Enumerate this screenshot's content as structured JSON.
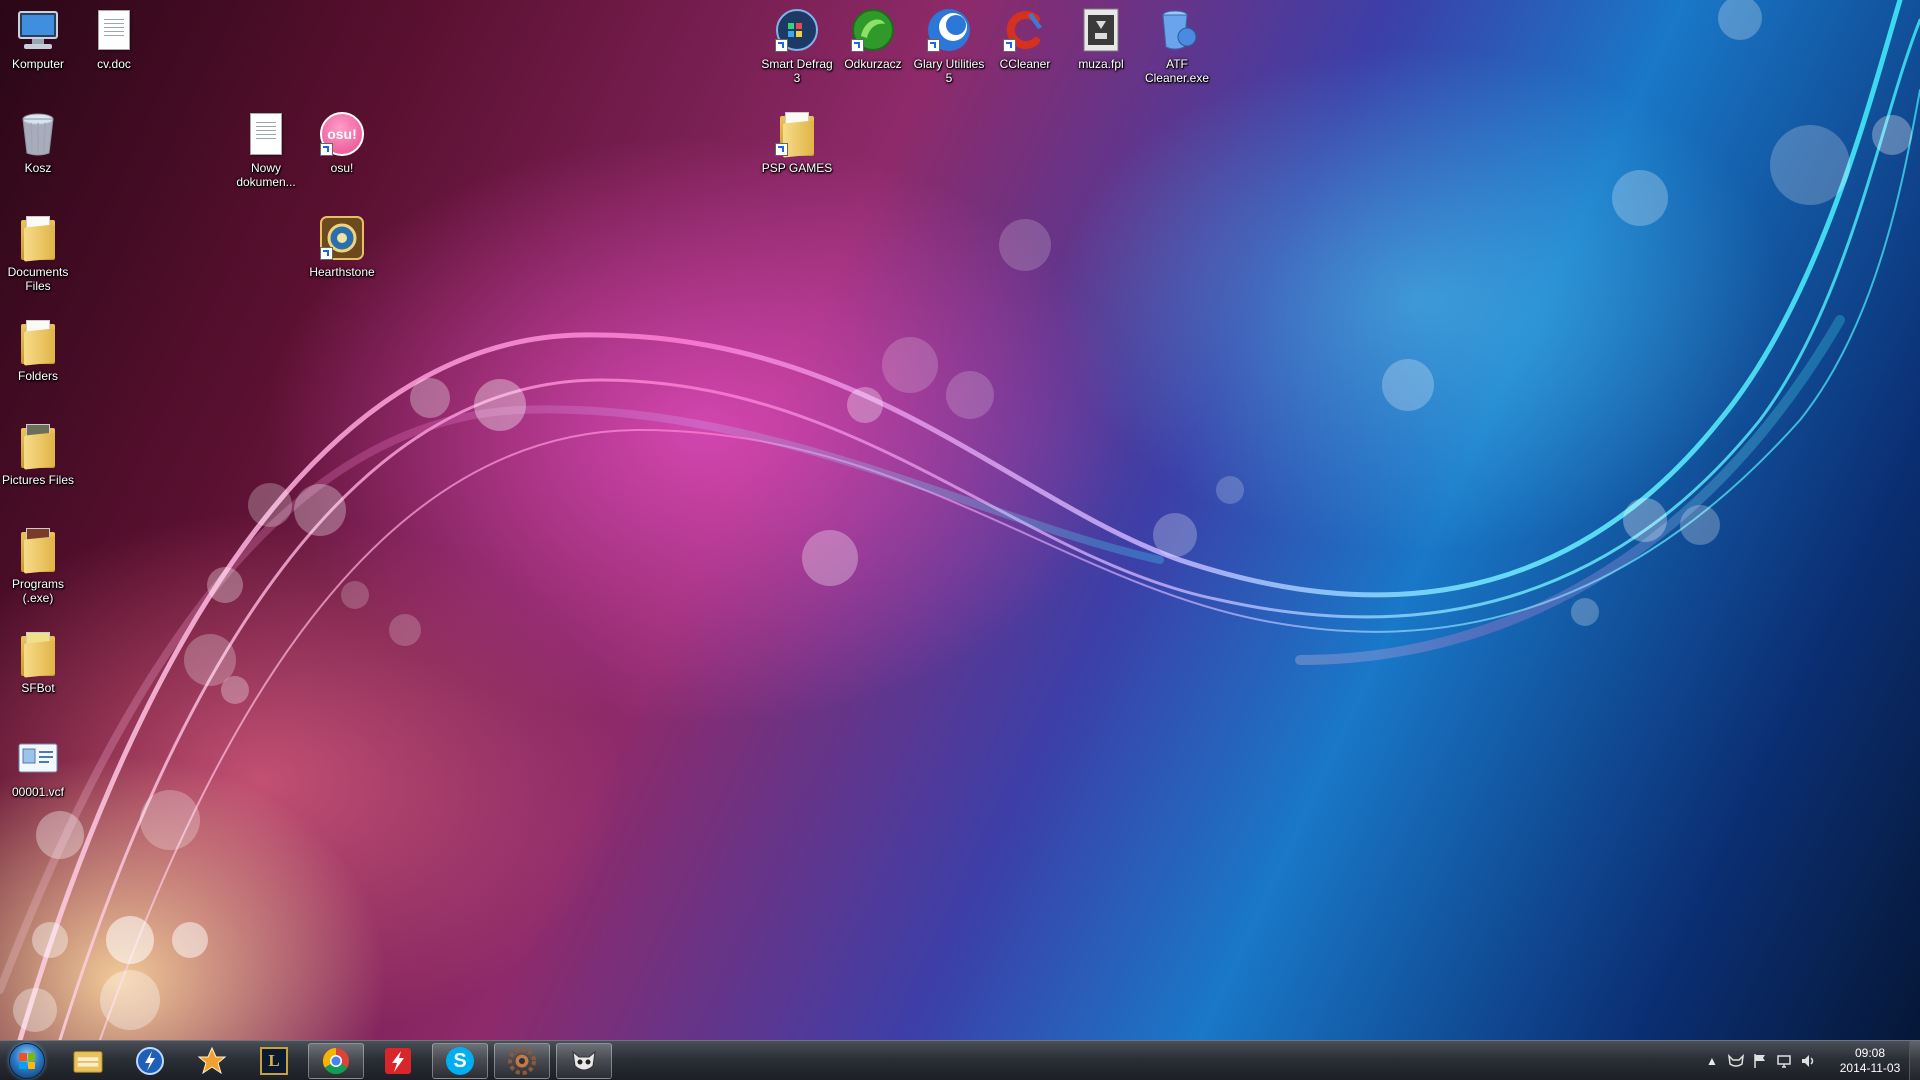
{
  "desktop": {
    "icons": {
      "komputer": "Komputer",
      "cv_doc": "cv.doc",
      "kosz": "Kosz",
      "nowy_dokument": "Nowy dokumen...",
      "osu": "osu!",
      "osu_logo_text": "osu!",
      "documents_files": "Documents Files",
      "hearthstone": "Hearthstone",
      "folders": "Folders",
      "pictures_files": "Pictures Files",
      "programs": "Programs (.exe)",
      "sfbot": "SFBot",
      "vcf": "00001.vcf",
      "smart_defrag": "Smart Defrag 3",
      "odkurzacz": "Odkurzacz",
      "glary": "Glary Utilities 5",
      "ccleaner": "CCleaner",
      "muza": "muza.fpl",
      "atf": "ATF Cleaner.exe",
      "psp_games": "PSP GAMES"
    }
  },
  "taskbar": {
    "pinned": [
      {
        "name": "windows-explorer",
        "icon": "folder-icon"
      },
      {
        "name": "thunder",
        "icon": "lightning-icon"
      },
      {
        "name": "app-star",
        "icon": "star-icon"
      },
      {
        "name": "league-of-legends",
        "icon": "lol-icon"
      },
      {
        "name": "google-chrome",
        "icon": "chrome-icon"
      },
      {
        "name": "flash",
        "icon": "flash-icon"
      },
      {
        "name": "skype",
        "icon": "skype-icon"
      },
      {
        "name": "settings-app",
        "icon": "gear-icon"
      },
      {
        "name": "mascot-app",
        "icon": "cat-icon"
      }
    ],
    "skype_letter": "S",
    "lol_letter": "L",
    "clock": {
      "time": "09:08",
      "date": "2014-11-03"
    }
  },
  "colors": {
    "taskbar_bg": "#2b2f36",
    "win_orb": "#2a7cc7",
    "wallpaper_pink": "#e050c8",
    "wallpaper_cyan": "#30d8f0"
  }
}
